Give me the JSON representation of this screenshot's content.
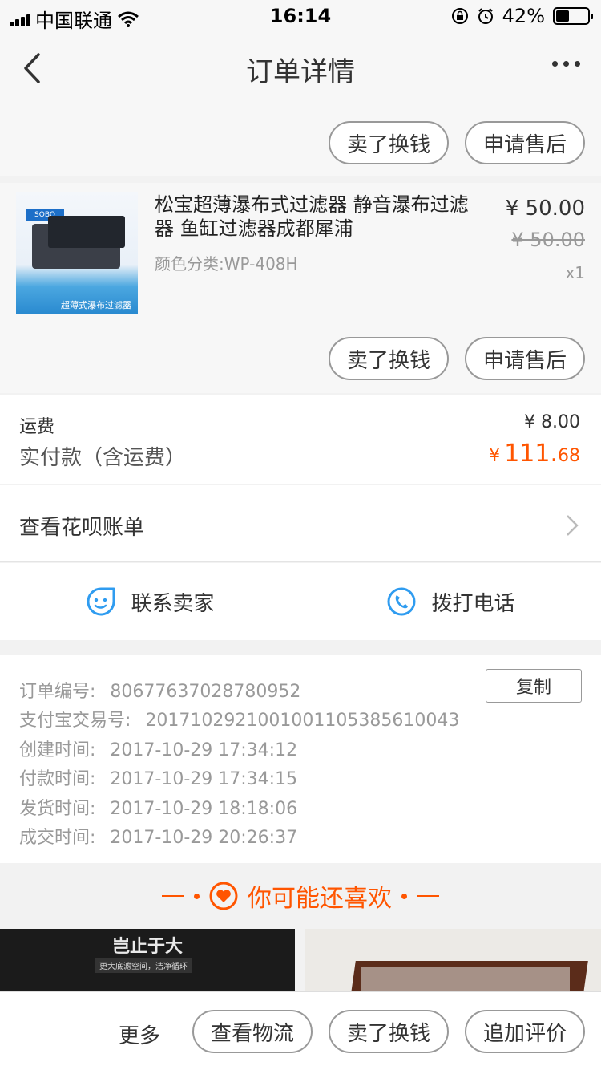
{
  "status_bar": {
    "carrier": "中国联通",
    "time": "16:14",
    "battery_percent": "42%",
    "battery_level": 0.42
  },
  "nav": {
    "title": "订单详情"
  },
  "top_actions": {
    "sell_label": "卖了换钱",
    "after_sale_label": "申请售后"
  },
  "product": {
    "name": "松宝超薄瀑布式过滤器 静音瀑布过滤器 鱼缸过滤器成都犀浦",
    "spec": "颜色分类:WP-408H",
    "price": "¥ 50.00",
    "original_price": "¥ 50.00",
    "quantity": "x1",
    "sell_label": "卖了换钱",
    "after_sale_label": "申请售后",
    "thumb_text_brand": "SOBO",
    "thumb_text_caption": "超薄式瀑布过滤器"
  },
  "fees": {
    "shipping_label": "运费",
    "shipping_value": "¥ 8.00",
    "paid_label": "实付款（含运费）",
    "paid_currency": "¥",
    "paid_integer": "111.",
    "paid_decimal": "68"
  },
  "huabei": {
    "label": "查看花呗账单"
  },
  "contact": {
    "seller_label": "联系卖家",
    "call_label": "拨打电话"
  },
  "order_info": {
    "copy_label": "复制",
    "rows": [
      {
        "key": "订单编号:",
        "value": "80677637028780952"
      },
      {
        "key": "支付宝交易号:",
        "value": "2017102921001001105385610043"
      },
      {
        "key": "创建时间:",
        "value": "2017-10-29 17:34:12"
      },
      {
        "key": "付款时间:",
        "value": "2017-10-29 17:34:15"
      },
      {
        "key": "发货时间:",
        "value": "2017-10-29 18:18:06"
      },
      {
        "key": "成交时间:",
        "value": "2017-10-29 20:26:37"
      }
    ]
  },
  "recommend": {
    "title": "你可能还喜欢",
    "item1_headline": "岂止于大",
    "item1_sub": "更大底滤空间，洁净循环"
  },
  "bottom_bar": {
    "more_label": "更多",
    "logistics_label": "查看物流",
    "sell_label": "卖了换钱",
    "review_label": "追加评价"
  },
  "colors": {
    "accent": "#ff5500",
    "icon_blue": "#2f9cf0"
  }
}
